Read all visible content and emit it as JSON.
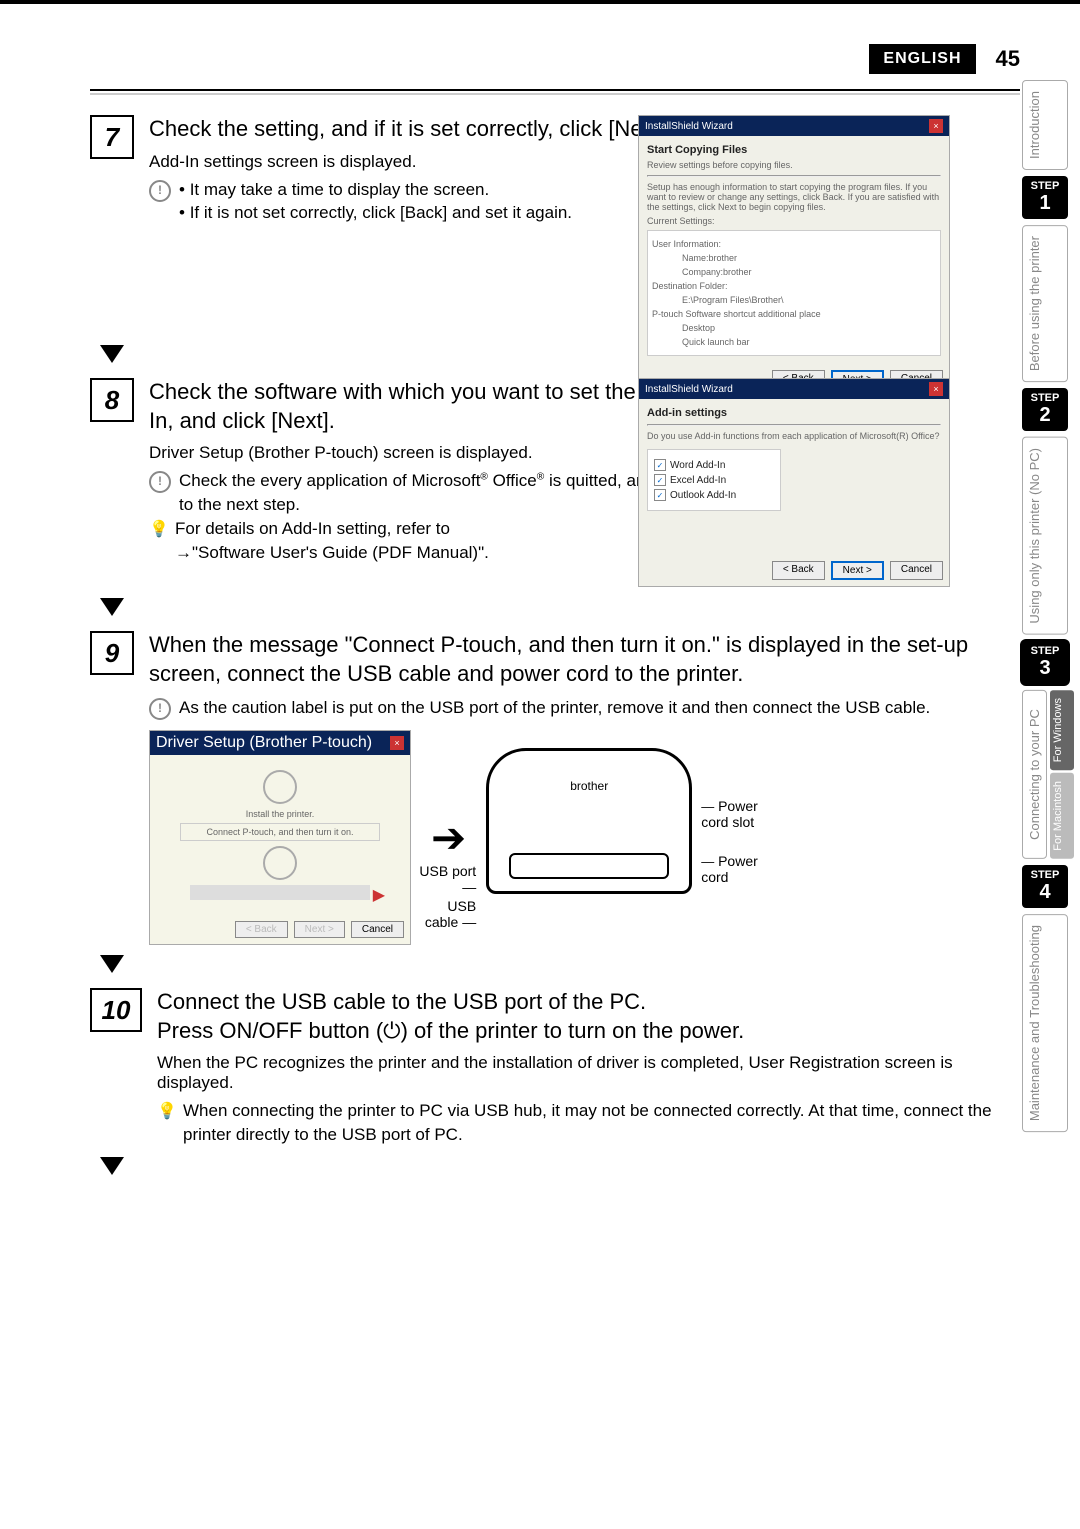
{
  "header": {
    "lang": "ENGLISH",
    "page": "45"
  },
  "steps": {
    "s7": {
      "n": "7",
      "title": "Check the setting, and if it is set correctly, click [Next].",
      "desc": "Add-In settings screen is displayed.",
      "b1": "It may take a time to display the screen.",
      "b2": "If it is not set correctly, click [Back] and set it again."
    },
    "s8": {
      "n": "8",
      "title": "Check the software with which you want to set the Add-In, and click [Next].",
      "desc": "Driver Setup (Brother P-touch) screen is displayed.",
      "b1": "Check the every application of Microsoft",
      "b1b": " is quitted, and go to the next step.",
      "office": "Office",
      "b2": "For details on Add-In setting, refer to",
      "b3": "→\"Software User's Guide (PDF Manual)\"."
    },
    "s9": {
      "n": "9",
      "title": "When the message \"Connect P-touch, and then turn it on.\" is displayed in the set-up screen, connect the USB cable and power cord to the printer.",
      "b1": "As the caution label is put on the USB port of the printer, remove it and then connect the USB cable."
    },
    "s10": {
      "n": "10",
      "l1": "Connect the USB cable to the USB port of the PC.",
      "l2": "Press ON/OFF button (⏻) of the printer to turn on the power.",
      "desc": "When the PC recognizes the printer and the installation of driver is completed, User Registration screen is displayed.",
      "b1": "When connecting the printer to PC via USB hub, it may not be connected correctly. At that time, connect the printer directly to the USB port of PC."
    }
  },
  "ss7": {
    "title": "InstallShield Wizard",
    "h": "Start Copying Files",
    "sub": "Review settings before copying files.",
    "p": "Setup has enough information to start copying the program files. If you want to review or change any settings, click Back. If you are satisfied with the settings, click Next to begin copying files.",
    "cs": "Current Settings:",
    "ui": "User Information:",
    "name": "Name:brother",
    "comp": "Company:brother",
    "df": "Destination Folder:",
    "path": "E:\\Program Files\\Brother\\",
    "sp": "P-touch Software shortcut additional place",
    "d": "Desktop",
    "q": "Quick launch bar",
    "back": "< Back",
    "next": "Next >",
    "cancel": "Cancel"
  },
  "ss8": {
    "title": "InstallShield Wizard",
    "h": "Add-in settings",
    "q": "Do you use Add-in functions from each application of Microsoft(R) Office?",
    "c1": "Word Add-In",
    "c2": "Excel Add-In",
    "c3": "Outlook Add-In",
    "back": "< Back",
    "next": "Next >",
    "cancel": "Cancel"
  },
  "ss9": {
    "title": "Driver Setup (Brother P-touch)",
    "h": "Install the printer.",
    "msg": "Connect P-touch, and then turn it on.",
    "back": "< Back",
    "next": "Next >",
    "cancel": "Cancel"
  },
  "diagram": {
    "brand": "brother",
    "usb_port": "USB port",
    "usb_cable": "USB cable",
    "pc_slot": "Power cord slot",
    "pc": "Power cord"
  },
  "sidebar": {
    "intro": "Introduction",
    "before": "Before using the",
    "printer": "printer",
    "only": "Using only this printer",
    "nopc": "(No PC)",
    "conn": "Connecting to your PC",
    "win": "For Windows",
    "mac": "For Macintosh",
    "maint": "Maintenance and",
    "trouble": "Troubleshooting",
    "step": "STEP"
  },
  "steps_n": {
    "n1": "1",
    "n2": "2",
    "n3": "3",
    "n4": "4"
  }
}
